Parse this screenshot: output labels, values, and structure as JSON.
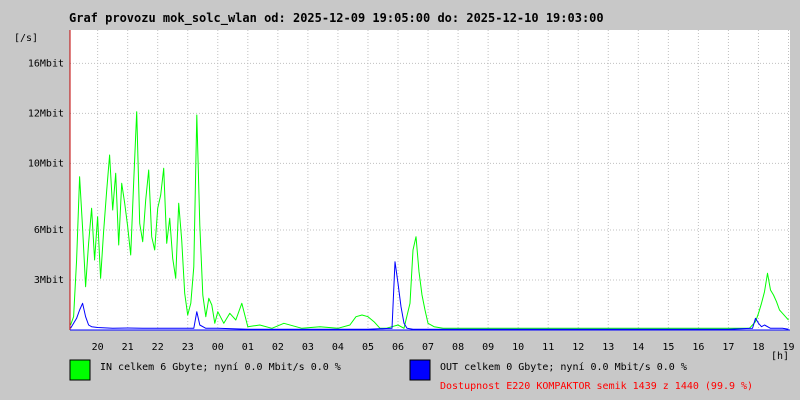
{
  "chart_data": {
    "type": "area",
    "title": "Graf provozu mok_solc_wlan od: 2025-12-09 19:05:00 do: 2025-12-10 19:03:00",
    "ylabel": "[/s]",
    "xlabel": "[h]",
    "ylim": [
      0,
      18
    ],
    "y_ticks": [
      {
        "value": 3,
        "label": "3Mbit"
      },
      {
        "value": 6,
        "label": "6Mbit"
      },
      {
        "value": 10,
        "label": "10Mbit"
      },
      {
        "value": 13,
        "label": "12Mbit"
      },
      {
        "value": 16,
        "label": "16Mbit"
      }
    ],
    "x_range_hours": [
      19.08,
      43.05
    ],
    "x_ticks": [
      {
        "value": 20,
        "label": "20"
      },
      {
        "value": 21,
        "label": "21"
      },
      {
        "value": 22,
        "label": "22"
      },
      {
        "value": 23,
        "label": "23"
      },
      {
        "value": 24,
        "label": "00"
      },
      {
        "value": 25,
        "label": "01"
      },
      {
        "value": 26,
        "label": "02"
      },
      {
        "value": 27,
        "label": "03"
      },
      {
        "value": 28,
        "label": "04"
      },
      {
        "value": 29,
        "label": "05"
      },
      {
        "value": 30,
        "label": "06"
      },
      {
        "value": 31,
        "label": "07"
      },
      {
        "value": 32,
        "label": "08"
      },
      {
        "value": 33,
        "label": "09"
      },
      {
        "value": 34,
        "label": "10"
      },
      {
        "value": 35,
        "label": "11"
      },
      {
        "value": 36,
        "label": "12"
      },
      {
        "value": 37,
        "label": "13"
      },
      {
        "value": 38,
        "label": "14"
      },
      {
        "value": 39,
        "label": "15"
      },
      {
        "value": 40,
        "label": "16"
      },
      {
        "value": 41,
        "label": "17"
      },
      {
        "value": 42,
        "label": "18"
      },
      {
        "value": 43,
        "label": "19"
      }
    ],
    "grid": true,
    "legend_position": "bottom",
    "series": [
      {
        "name": "IN celkem 6 Gbyte; nyní 0.0 Mbit/s 0.0 %",
        "color": "#00ff00",
        "x": [
          19.1,
          19.2,
          19.3,
          19.4,
          19.5,
          19.6,
          19.7,
          19.8,
          19.9,
          20.0,
          20.1,
          20.2,
          20.3,
          20.4,
          20.5,
          20.6,
          20.7,
          20.8,
          20.9,
          21.0,
          21.1,
          21.2,
          21.3,
          21.4,
          21.5,
          21.6,
          21.7,
          21.8,
          21.9,
          22.0,
          22.1,
          22.2,
          22.3,
          22.4,
          22.5,
          22.6,
          22.7,
          22.8,
          22.9,
          23.0,
          23.1,
          23.2,
          23.3,
          23.4,
          23.5,
          23.6,
          23.7,
          23.8,
          23.9,
          24.0,
          24.2,
          24.4,
          24.6,
          24.8,
          25.0,
          25.4,
          25.8,
          26.2,
          26.8,
          27.4,
          28.0,
          28.4,
          28.6,
          28.8,
          29.0,
          29.2,
          29.4,
          29.6,
          29.8,
          30.0,
          30.2,
          30.4,
          30.5,
          30.6,
          30.7,
          30.8,
          30.9,
          31.0,
          31.2,
          31.5,
          32.0,
          33.0,
          34.0,
          35.0,
          36.0,
          37.0,
          38.0,
          39.0,
          40.0,
          41.0,
          41.5,
          41.7,
          41.9,
          42.0,
          42.1,
          42.2,
          42.3,
          42.4,
          42.5,
          42.6,
          42.7,
          42.8,
          42.9,
          43.0
        ],
        "values": [
          0.3,
          0.8,
          4.2,
          9.2,
          6.1,
          2.6,
          5.2,
          7.3,
          4.2,
          6.8,
          3.1,
          5.9,
          8.3,
          10.5,
          7.2,
          9.4,
          5.1,
          8.8,
          7.6,
          6.2,
          4.5,
          8.9,
          13.1,
          6.4,
          5.3,
          7.8,
          9.6,
          5.6,
          4.8,
          7.3,
          8.1,
          9.7,
          5.2,
          6.7,
          4.3,
          3.1,
          7.6,
          5.4,
          2.2,
          0.9,
          1.6,
          3.8,
          12.9,
          6.3,
          2.1,
          0.8,
          1.9,
          1.5,
          0.4,
          1.1,
          0.4,
          1.0,
          0.6,
          1.6,
          0.2,
          0.3,
          0.1,
          0.4,
          0.1,
          0.2,
          0.1,
          0.3,
          0.8,
          0.9,
          0.8,
          0.5,
          0.1,
          0.1,
          0.2,
          0.3,
          0.1,
          1.6,
          4.8,
          5.6,
          3.5,
          2.1,
          1.2,
          0.4,
          0.2,
          0.1,
          0.1,
          0.1,
          0.1,
          0.1,
          0.1,
          0.1,
          0.1,
          0.1,
          0.1,
          0.1,
          0.1,
          0.1,
          0.5,
          1.0,
          1.6,
          2.3,
          3.4,
          2.4,
          2.1,
          1.7,
          1.2,
          1.0,
          0.8,
          0.6
        ]
      },
      {
        "name": "OUT celkem 0 Gbyte; nyní 0.0 Mbit/s 0.0 %",
        "color": "#0000ff",
        "x": [
          19.1,
          19.2,
          19.3,
          19.4,
          19.5,
          19.6,
          19.7,
          19.8,
          20.0,
          20.5,
          21.0,
          21.5,
          22.0,
          22.5,
          23.0,
          23.2,
          23.3,
          23.4,
          23.6,
          24.0,
          25.0,
          26.0,
          27.0,
          28.0,
          29.0,
          29.8,
          29.9,
          30.0,
          30.1,
          30.2,
          30.3,
          30.5,
          31.0,
          32.0,
          33.0,
          34.0,
          35.0,
          36.0,
          37.0,
          38.0,
          39.0,
          40.0,
          41.0,
          41.8,
          41.9,
          42.0,
          42.1,
          42.2,
          42.4,
          42.6,
          42.8,
          43.0
        ],
        "values": [
          0.1,
          0.4,
          0.7,
          1.2,
          1.6,
          0.8,
          0.3,
          0.2,
          0.15,
          0.1,
          0.12,
          0.1,
          0.1,
          0.1,
          0.1,
          0.1,
          1.1,
          0.3,
          0.1,
          0.1,
          0.05,
          0.05,
          0.05,
          0.05,
          0.05,
          0.1,
          4.1,
          2.8,
          1.4,
          0.4,
          0.1,
          0.05,
          0.05,
          0.05,
          0.05,
          0.05,
          0.05,
          0.05,
          0.05,
          0.05,
          0.05,
          0.05,
          0.05,
          0.1,
          0.7,
          0.4,
          0.2,
          0.3,
          0.1,
          0.1,
          0.1,
          0.05
        ]
      }
    ],
    "footer_note": "Dostupnost E220 KOMPAKTOR semik 1439 z 1440 (99.9 %)"
  },
  "colors": {
    "background": "#c8c8c8",
    "plot_bg": "#ffffff",
    "grid": "#c0c0c0",
    "axis_left": "#c00000",
    "axis_bottom": "#0000ff",
    "note": "#ff0000"
  }
}
